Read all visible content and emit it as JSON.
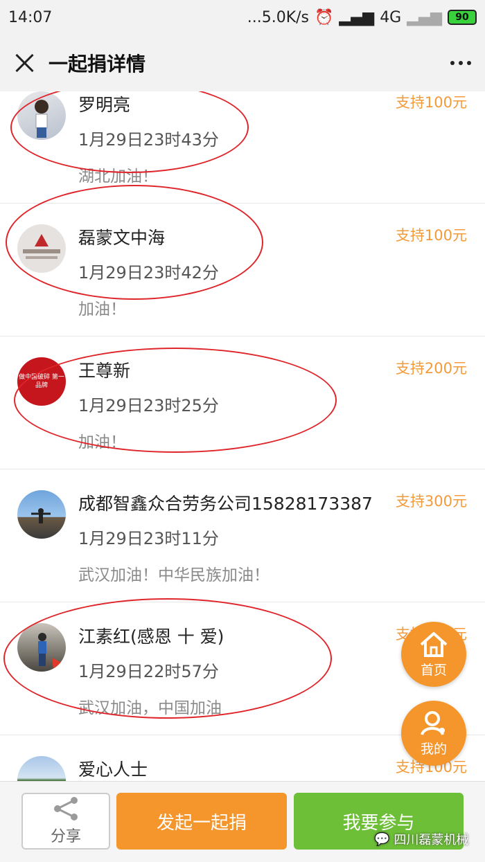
{
  "status_bar": {
    "time": "14:07",
    "net_speed": "...5.0K/s",
    "network": "4G",
    "battery": "90"
  },
  "nav": {
    "title": "一起捐详情"
  },
  "donations": [
    {
      "name": "罗明亮",
      "time": "1月29日23时43分",
      "message": "湖北加油！",
      "amount": "支持100元"
    },
    {
      "name": "磊蒙文中海",
      "time": "1月29日23时42分",
      "message": "加油！",
      "amount": "支持100元"
    },
    {
      "name": "王尊新",
      "time": "1月29日23时25分",
      "message": "加油！",
      "amount": "支持200元",
      "avatar_text": "做中国破碎 第一品牌"
    },
    {
      "name": "成都智鑫众合劳务公司15828173387",
      "time": "1月29日23时11分",
      "message": "武汉加油！中华民族加油！",
      "amount": "支持300元"
    },
    {
      "name": "江素红(感恩 十 爱)",
      "time": "1月29日22时57分",
      "message": "武汉加油，中国加油",
      "amount": "支持100元"
    },
    {
      "name": "爱心人士",
      "time": "",
      "message": "",
      "amount": "支持100元"
    }
  ],
  "fab": {
    "home_label": "首页",
    "mine_label": "我的"
  },
  "bottom": {
    "share_label": "分享",
    "start_label": "发起一起捐",
    "join_label": "我要参与"
  },
  "watermark": "四川磊蒙机械",
  "colors": {
    "accent_orange": "#f4962c",
    "green": "#6cbf37",
    "annotation_red": "#e0252a"
  }
}
